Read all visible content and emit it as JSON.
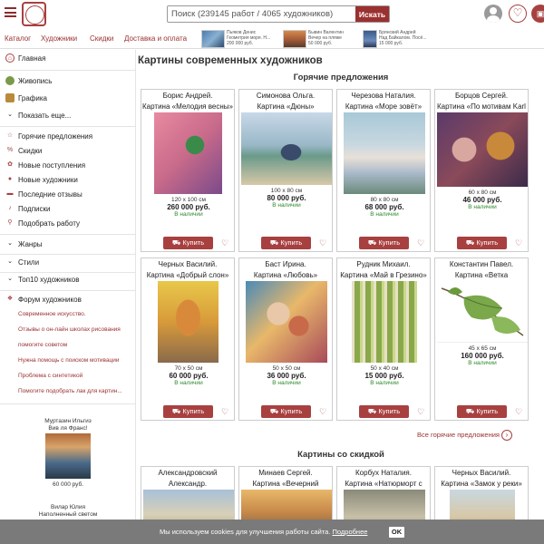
{
  "header": {
    "search_placeholder": "Поиск (239145 работ / 4065 художников)",
    "search_button": "Искать"
  },
  "topnav": {
    "items": [
      "Каталог",
      "Художники",
      "Скидки",
      "Доставка и оплата"
    ],
    "promos": [
      {
        "line1": "Пьяков Денис",
        "line2": "Геометрия моря. Н...",
        "line3": "200 000 руб."
      },
      {
        "line1": "Бывин Валентин",
        "line2": "Вечер на пляже",
        "line3": "50 000 руб."
      },
      {
        "line1": "Брянский Андрей",
        "line2": "Над Байкалом. Посё...",
        "line3": "15 000 руб."
      }
    ]
  },
  "sidebar": {
    "home": "Главная",
    "painting": "Живопись",
    "graphics": "Графика",
    "more": "Показать еще...",
    "hot": "Горячие предложения",
    "discounts": "Скидки",
    "new_arrivals": "Новые поступления",
    "new_artists": "Новые художники",
    "reviews": "Последние отзывы",
    "subscriptions": "Подписки",
    "pick": "Подобрать работу",
    "genres": "Жанры",
    "styles": "Стили",
    "top10": "Топ10 художников",
    "forum": "Форум художников",
    "forum_topics": [
      "Современное искусство.",
      "Отзывы о он-лайн школах рисования",
      "помогите советом",
      "Нужна помощь с поиском мотивации",
      "Проблема с синтетикой",
      "Помогите подобрать лак для картин..."
    ],
    "featured": [
      {
        "artist": "Муртазин Ильгиз",
        "title": "Вив ля Франс!",
        "price": "60 000 руб."
      },
      {
        "artist": "Вилар Юлия",
        "title": "Наполненный светом"
      }
    ]
  },
  "main": {
    "page_title": "Картины современных художников",
    "hot_title": "Горячие предложения",
    "buy_label": "Купить",
    "available": "В наличии",
    "all_hot": "Все горячие предложения",
    "discount_title": "Картины со скидкой",
    "hot_cards": [
      {
        "artist": "Борис Андрей.",
        "title": "Картина «Мелодия весны»",
        "size": "120 x 100 см",
        "price": "260 000 руб."
      },
      {
        "artist": "Симонова Ольга.",
        "title": "Картина «Дюны»",
        "size": "100 x 80 см",
        "price": "80 000 руб."
      },
      {
        "artist": "Черезова Наталия.",
        "title": "Картина «Море зовёт»",
        "size": "80 x 80 см",
        "price": "68 000 руб."
      },
      {
        "artist": "Борцов Сергей.",
        "title": "Картина «По мотивам Karl",
        "size": "60 x 80 см",
        "price": "46 000 руб."
      },
      {
        "artist": "Черных Василий.",
        "title": "Картина «Добрый слон»",
        "size": "70 x 50 см",
        "price": "60 000 руб."
      },
      {
        "artist": "Баст Ирина.",
        "title": "Картина «Любовь»",
        "size": "50 x 50 см",
        "price": "36 000 руб."
      },
      {
        "artist": "Рудник Михаил.",
        "title": "Картина «Май в Грезино»",
        "size": "50 x 40 см",
        "price": "15 000 руб."
      },
      {
        "artist": "Константин Павел.",
        "title": "Картина «Ветка",
        "size": "45 x 65 см",
        "price": "160 000 руб."
      }
    ],
    "discount_cards": [
      {
        "artist": "Александровский",
        "title": "Александр."
      },
      {
        "artist": "Минаев Сергей.",
        "title": "Картина «Вечерний"
      },
      {
        "artist": "Корбух Наталия.",
        "title": "Картина «Натюрморт с"
      },
      {
        "artist": "Черных Василий.",
        "title": "Картина «Замок у реки»"
      }
    ]
  },
  "cookie": {
    "message": "Мы используем cookies для улучшения работы сайта.",
    "link": "Подробнее",
    "ok": "OK"
  }
}
